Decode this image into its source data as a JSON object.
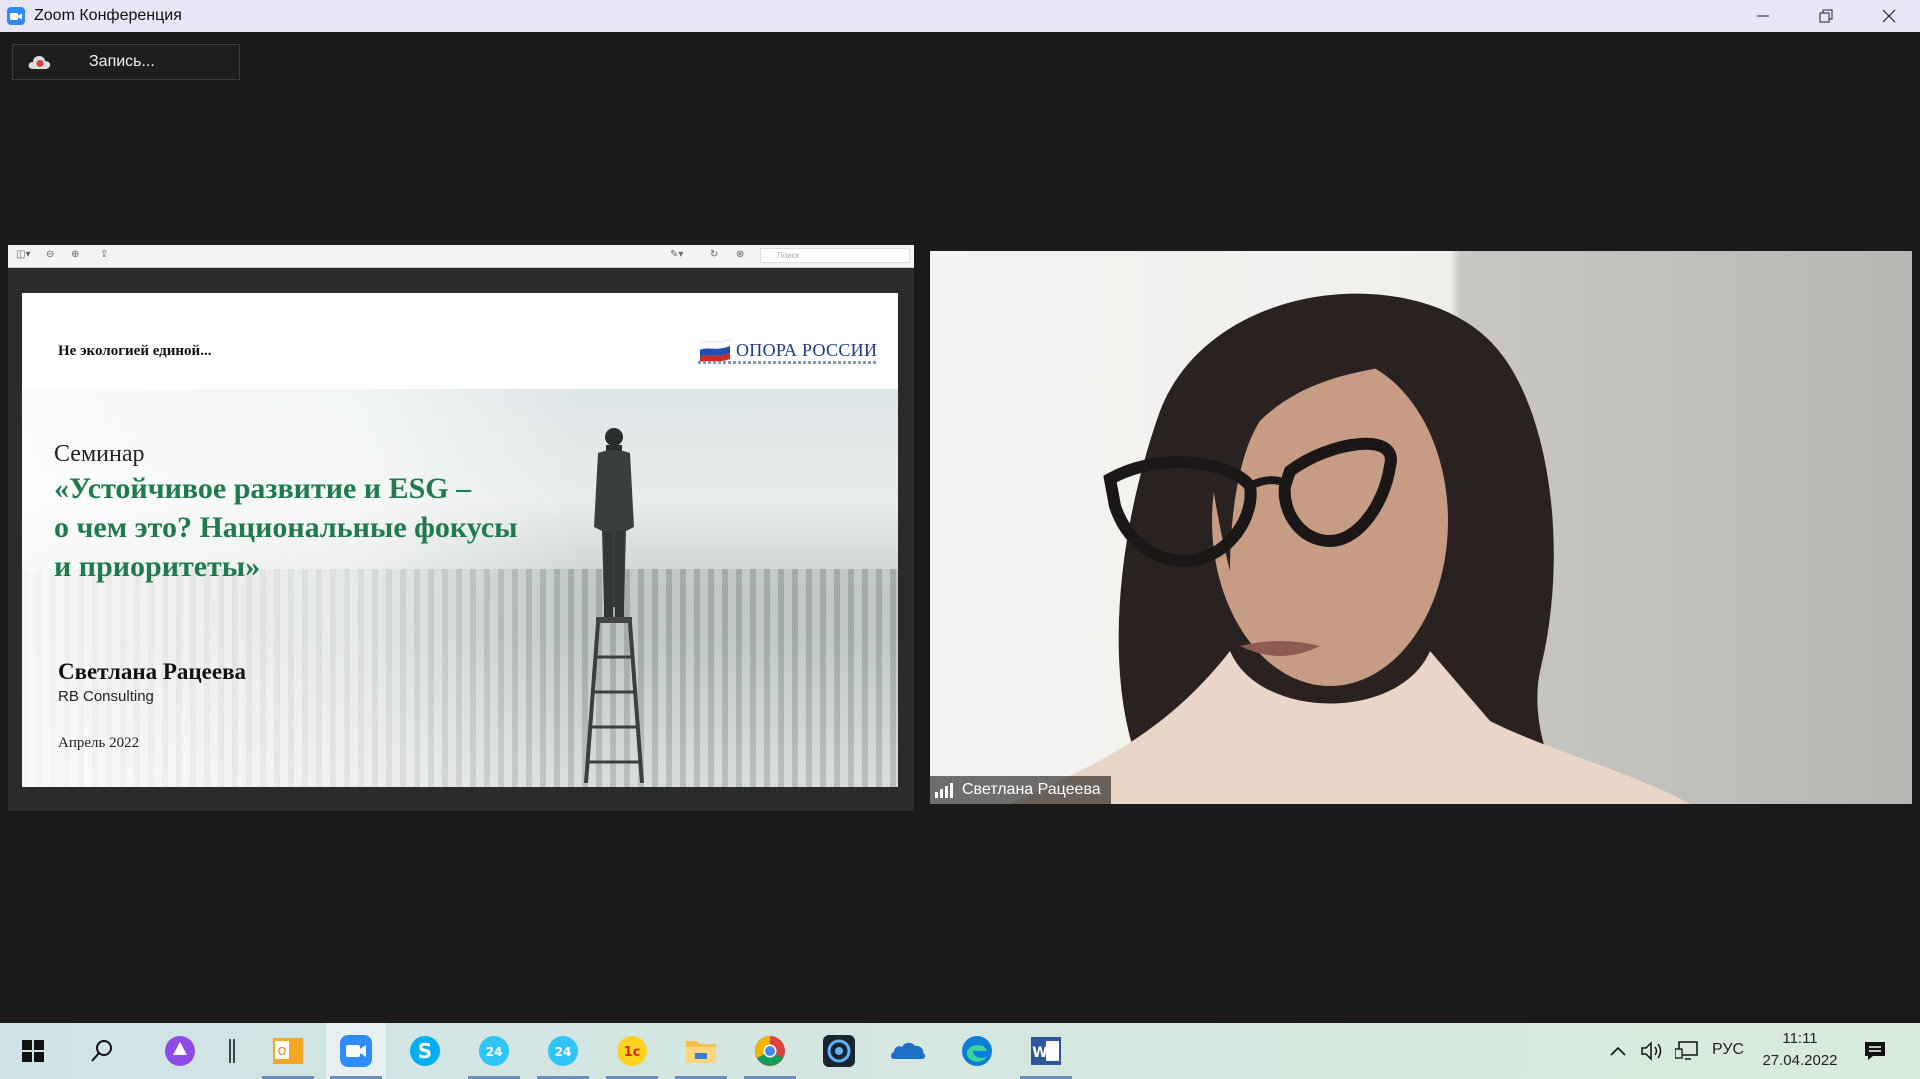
{
  "window": {
    "title": "Zoom Конференция",
    "controls": [
      "minimize-icon",
      "restore-icon",
      "close-icon"
    ]
  },
  "recording": {
    "label": "Запись..."
  },
  "share": {
    "viewer_search_placeholder": "Поиск",
    "slide": {
      "header_text": "Не экологией единой...",
      "logo_text": "ОПОРА РОССИИ",
      "seminar": "Семинар",
      "headline_lines": [
        "«Устойчивое развитие и ESG –",
        "о чем это? Национальные фокусы",
        "и приоритеты»"
      ],
      "speaker": "Светлана Рацеева",
      "company": "RB Consulting",
      "date": "Апрель 2022"
    }
  },
  "video": {
    "participant_name": "Светлана Рацеева"
  },
  "taskbar": {
    "apps": [
      {
        "name": "start-icon"
      },
      {
        "name": "search-icon"
      },
      {
        "name": "cortana-icon"
      },
      {
        "name": "outlook-icon"
      },
      {
        "name": "zoom-icon"
      },
      {
        "name": "skype-icon"
      },
      {
        "name": "bitrix24-icon"
      },
      {
        "name": "bitrix24-icon"
      },
      {
        "name": "1c-icon"
      },
      {
        "name": "file-explorer-icon"
      },
      {
        "name": "chrome-icon"
      },
      {
        "name": "camera-icon"
      },
      {
        "name": "onedrive-icon"
      },
      {
        "name": "edge-icon"
      },
      {
        "name": "word-icon"
      }
    ],
    "tray": {
      "language": "РУС",
      "time": "11:11",
      "date": "27.04.2022"
    }
  }
}
